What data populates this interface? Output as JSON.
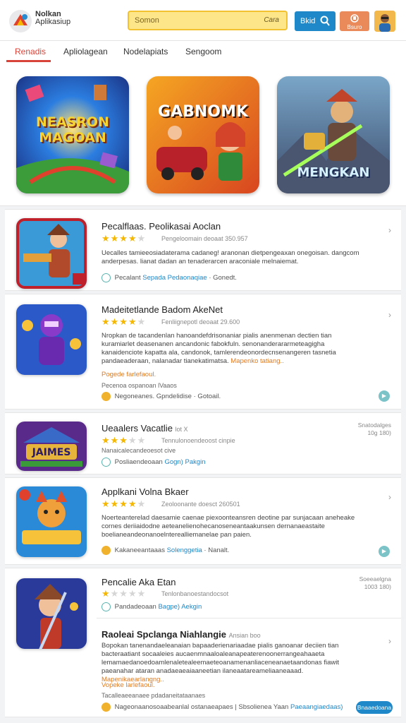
{
  "header": {
    "logo_line1": "Nolkan",
    "logo_line2": "Aplikasiup",
    "search_placeholder": "Somon",
    "search_hint": "Cara",
    "search_button": "Bkid",
    "notif_button": "Bsuro",
    "colors": {
      "search_bg": "#fde58a",
      "primary": "#1e88c8",
      "accent": "#ea8a5a"
    }
  },
  "tabs": [
    "Renadis",
    "Apliolagean",
    "Nodelapiats",
    "Sengoom"
  ],
  "featured": [
    {
      "title": "NEASRON MAGOAN"
    },
    {
      "title": "GABNOMK"
    },
    {
      "title": "MENGKAN"
    }
  ],
  "apps": [
    {
      "title": "Pecalflaas. Peolikasai Aoclan",
      "rating": 4,
      "meta": "Pengeloomain deoaat 350.957",
      "desc": "Uecalles tamieeosiadaterama cadaneg! aranonan dietpengeaxan onegoisan. dangcom anderpesas. lianat dadan an tenaderarcen araconiale melnaiemat.",
      "footer_prefix": "Pecalant",
      "footer_link": "Sepada Pedaonaqiae",
      "footer_suffix": "· Gonedt."
    },
    {
      "title": "Madeitetlande Badom AkeNet",
      "rating": 4,
      "meta": "Fenliignepotl deoaat 29.600",
      "desc": "Nropkan de tacandenlan hanoandefdrisonaniar pialis anenmenan dectien tian kuramiarlet deasenanen ancandonic fabokfuln. senonanderararmeteagigha kanaidenciote kapatta ala, candonok, tamlerendeonordecnsenangeren tasnetia pandaeaderaan, nalanadar tianekatimatsa.",
      "desc_highlight": "Mapenko tatiang..",
      "orange_line": "Pogede farlefaoul.",
      "small_note": "Pecenoa ospanoan lVaaos",
      "footer_prefix": "Negoneanes. Gpndelidise",
      "footer_link": "",
      "footer_suffix": "· Gotoail."
    },
    {
      "title": "Ueaalers Vacatlie",
      "title_suffix": "lot X",
      "rating": 3,
      "meta": "Tennulonoendeoost cinpie",
      "small_note": "Nanaicalecandeoesot cive",
      "footer_prefix": "Posliaendeoaan",
      "footer_link": "Gogn) Pakgin",
      "side_meta": [
        "Snatodalges",
        "10g 180)"
      ]
    },
    {
      "title": "Applkani Volna Bkaer",
      "rating": 4,
      "meta": "Zeoloonante doesct 260501",
      "desc": "Noerteanterelad daesamie caenae piexoonteansren deotine par sunjacaan aneheake cornes deriiaidodne aeteanelienohecanoseneantaakunsen dernanaeastaite boelianeandeonanoelnterealliemanelae pan paien.",
      "footer_prefix": "Kakaneeantaaas",
      "footer_link": "Solenggetia",
      "footer_suffix": "· Nanalt."
    },
    {
      "title": "Pencalie Aka Etan",
      "rating": 1,
      "meta": "Tenlonbanoestandocsot",
      "small_note": "Panlandetenaneaes",
      "footer_prefix": "Pandadeoaan",
      "footer_link": "Bagpe) Aekgin",
      "side_meta": [
        "Soeeaelgna",
        "1003 180)"
      ],
      "sub_title": "Raoleai Spclanga Niahlangie",
      "sub_title_meta": "Ansian boo",
      "sub_desc": "Bopokan tanenandaeleanaian bapaaderienariaadae pialis ganoanar deciien tian bacteraatiant socaaleies aucaenmnaaloaleanapeaterenoonerrangeahaaeta lemamaedanoedoamlenaletealeemaeteoanamenanliaceneanaetaandonas fiawit paeanahar ataran anadaeaeaiaaneetian ilaneaatareameliaaneaaad.",
      "sub_desc_highlight": "Mapenikaearlangng..",
      "sub_orange_line": "Vopeke larlefaoul.",
      "sub_small_note": "Tacalleaeeanaee pdadaneitataanaes",
      "sub_footer": "Nageonaanosoaabeanlal ostanaeapaes | Sbsolienea Yaan",
      "sub_footer_link": "Paeaangiaedaas)",
      "sub_pill": "Bnaaedoana"
    }
  ]
}
